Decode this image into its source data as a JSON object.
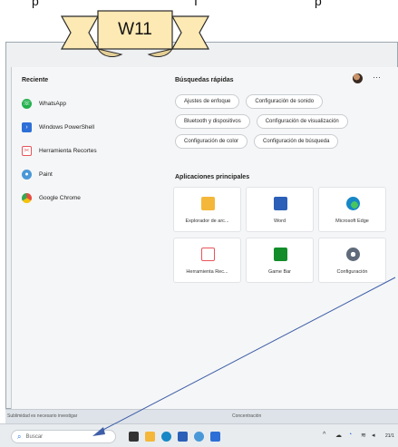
{
  "annotation": {
    "banner_label": "W11"
  },
  "start_menu": {
    "recent_title": "Reciente",
    "recent_items": [
      {
        "label": "WhatsApp",
        "icon": "whatsapp-icon",
        "color": "#21b04b"
      },
      {
        "label": "Windows PowerShell",
        "icon": "powershell-icon",
        "color": "#2d6fd6"
      },
      {
        "label": "Herramienta Recortes",
        "icon": "snipping-tool-icon",
        "color": "#e8545b"
      },
      {
        "label": "Paint",
        "icon": "paint-icon",
        "color": "#4a98d8"
      },
      {
        "label": "Google Chrome",
        "icon": "chrome-icon",
        "color": "#e84c3d"
      }
    ],
    "quick_searches_title": "Búsquedas rápidas",
    "quick_searches": [
      "Ajustes de enfoque",
      "Configuración de sonido",
      "Bluetooth y dispositivos",
      "Configuración de visualización",
      "Configuración de color",
      "Configuración de búsqueda"
    ],
    "top_apps_title": "Aplicaciones principales",
    "top_apps": [
      {
        "label": "Explorador de arc...",
        "icon": "file-explorer-icon",
        "color": "#f4b73a"
      },
      {
        "label": "Word",
        "icon": "word-icon",
        "color": "#2b5fb8"
      },
      {
        "label": "Microsoft Edge",
        "icon": "edge-icon",
        "color": "#1787c6"
      },
      {
        "label": "Herramienta Rec...",
        "icon": "snipping-tool-icon",
        "color": "#e8545b"
      },
      {
        "label": "Game Bar",
        "icon": "game-bar-icon",
        "color": "#128d2a"
      },
      {
        "label": "Configuración",
        "icon": "settings-icon",
        "color": "#5f6b7a"
      }
    ],
    "more_label": "···"
  },
  "inner_footer": {
    "left_text": "Sublimidad es necesario investigar",
    "right_text": "Concentración"
  },
  "taskbar": {
    "search_placeholder": "Buscar",
    "date_text": "21/1"
  }
}
